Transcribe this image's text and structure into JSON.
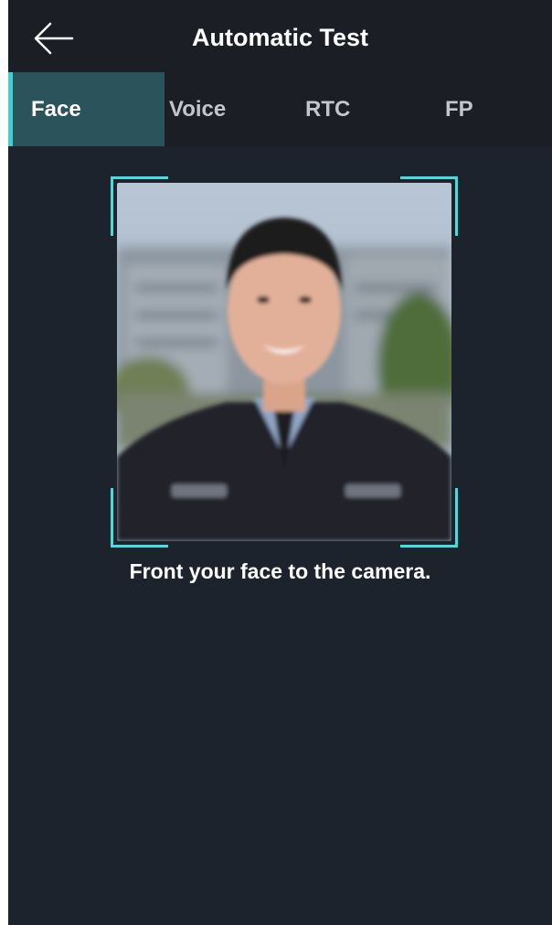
{
  "header": {
    "title": "Automatic Test",
    "back_icon": "arrow-left-icon"
  },
  "tabs": [
    {
      "label": "Face",
      "active": true
    },
    {
      "label": "Voice",
      "active": false
    },
    {
      "label": "RTC",
      "active": false
    },
    {
      "label": "FP",
      "active": false
    }
  ],
  "face_capture": {
    "hint": "Front your face to the camera.",
    "frame_color": "#3ee0e0"
  },
  "colors": {
    "background": "#1d232c",
    "header_background": "#1b1f25",
    "active_tab_background": "#2a535b",
    "accent": "#3ecfcf"
  }
}
